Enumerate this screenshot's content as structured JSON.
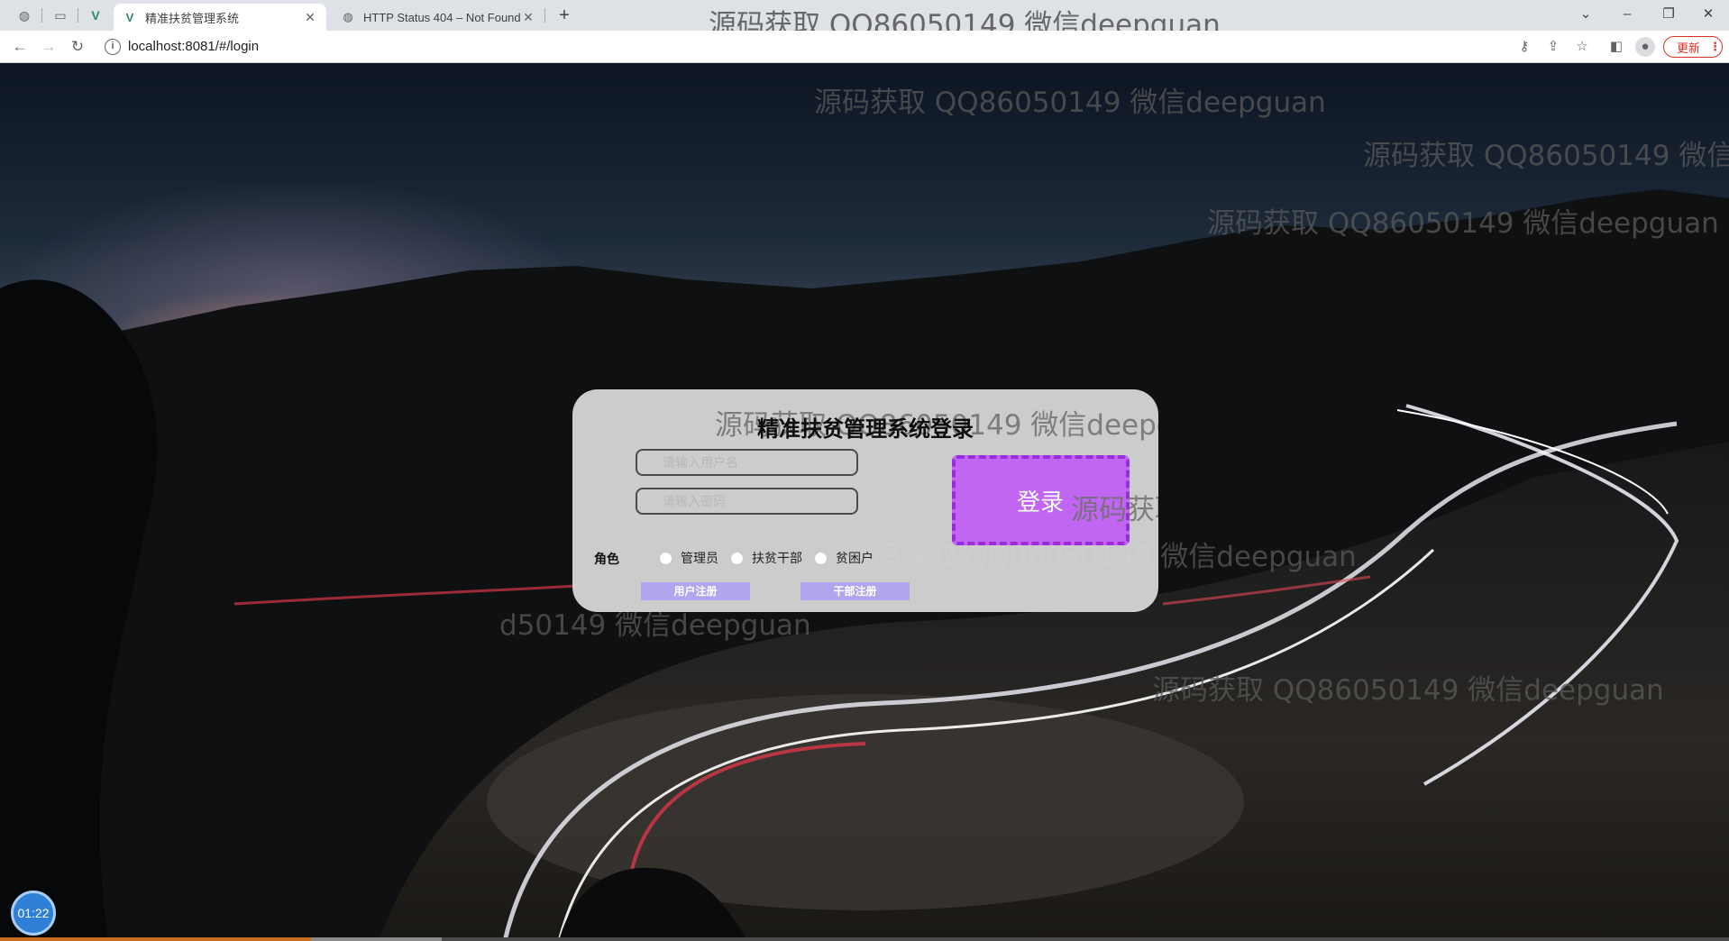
{
  "browser": {
    "tabs": [
      {
        "title": "精准扶贫管理系统",
        "icon": "vue-logo-icon",
        "active": true
      },
      {
        "title": "HTTP Status 404 – Not Found",
        "icon": "globe-icon",
        "active": false
      }
    ],
    "url": "localhost:8081/#/login",
    "update_label": "更新"
  },
  "watermark_text": "源码获取 QQ86050149 微信deepguan",
  "watermark_fragment_1": "源码获取",
  "watermark_fragment_2": "d50149 微信deepguan",
  "login": {
    "title": "精准扶贫管理系统登录",
    "username_placeholder": "请输入用户名",
    "password_placeholder": "请输入密码",
    "login_button": "登录",
    "role_label": "角色",
    "roles": [
      "管理员",
      "扶贫干部",
      "贫困户"
    ],
    "register_user": "用户注册",
    "register_cadre": "干部注册"
  },
  "timer": "01:22",
  "colors": {
    "login_button": "#c166f2",
    "login_button_border": "#9b2be0",
    "register_button": "#b1a6ee",
    "update_button": "#d93025"
  }
}
